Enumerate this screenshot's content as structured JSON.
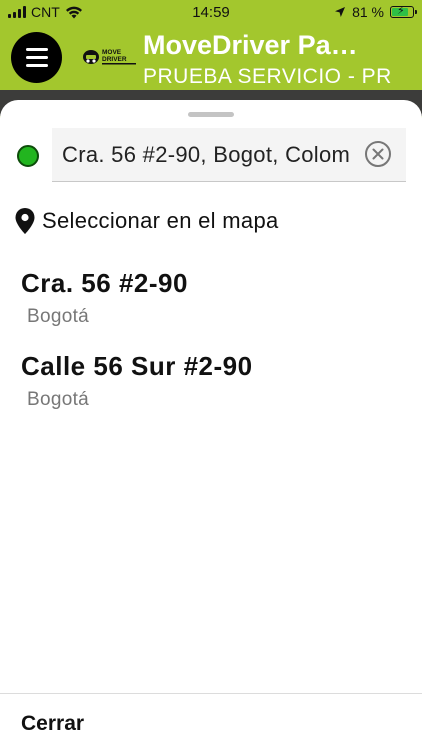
{
  "status_bar": {
    "carrier": "CNT",
    "time": "14:59",
    "battery_percent": "81 %",
    "battery_level": 0.81,
    "icons": [
      "signal-icon",
      "wifi-icon",
      "location-arrow-icon",
      "battery-charging-icon"
    ]
  },
  "app_bar": {
    "title": "MoveDriver Pa…",
    "subtitle": "PRUEBA SERVICIO - PR",
    "logo_text_line1": "MOVE",
    "logo_text_line2": "DRIVER",
    "menu_icon": "hamburger-menu-icon"
  },
  "search": {
    "value": "Cra. 56 #2-90, Bogot, Colom",
    "origin_marker_color": "#22b51f",
    "clear_icon": "clear-circle-icon"
  },
  "select_on_map": {
    "label": "Seleccionar en el mapa",
    "icon": "map-pin-icon"
  },
  "results": [
    {
      "title": "Cra. 56 #2-90",
      "subtitle": "Bogotá"
    },
    {
      "title": "Calle 56 Sur #2-90",
      "subtitle": "Bogotá"
    }
  ],
  "footer": {
    "close_label": "Cerrar"
  },
  "colors": {
    "brand_green": "#a3c72d",
    "origin_green": "#22b51f",
    "text_dark": "#111111",
    "text_muted": "#777777"
  }
}
